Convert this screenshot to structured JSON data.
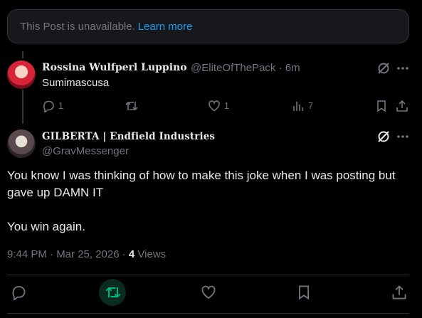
{
  "unavailable": {
    "text": "This Post is unavailable.",
    "learn_more": "Learn more"
  },
  "reply": {
    "display_name": "Rossina Wulfperl Luppino",
    "handle_time": "@EliteOfThePack · 6m",
    "text": "Sumimascusa",
    "stats": {
      "replies": "1",
      "reposts": "",
      "likes": "1",
      "views": "7"
    }
  },
  "post": {
    "display_name": "GILBERTA | Endfield Industries",
    "handle": "@GravMessenger",
    "line1": "You know I was thinking of how to make this joke when I was posting but gave up DAMN IT",
    "line2": "You win again.",
    "time_date": "9:44 PM · Mar 25, 2026 · ",
    "views_count": "4",
    "views_label": " Views"
  },
  "colors": {
    "accent": "#1d9bf0",
    "repost_active": "#00ba7c",
    "muted": "#71767b"
  }
}
